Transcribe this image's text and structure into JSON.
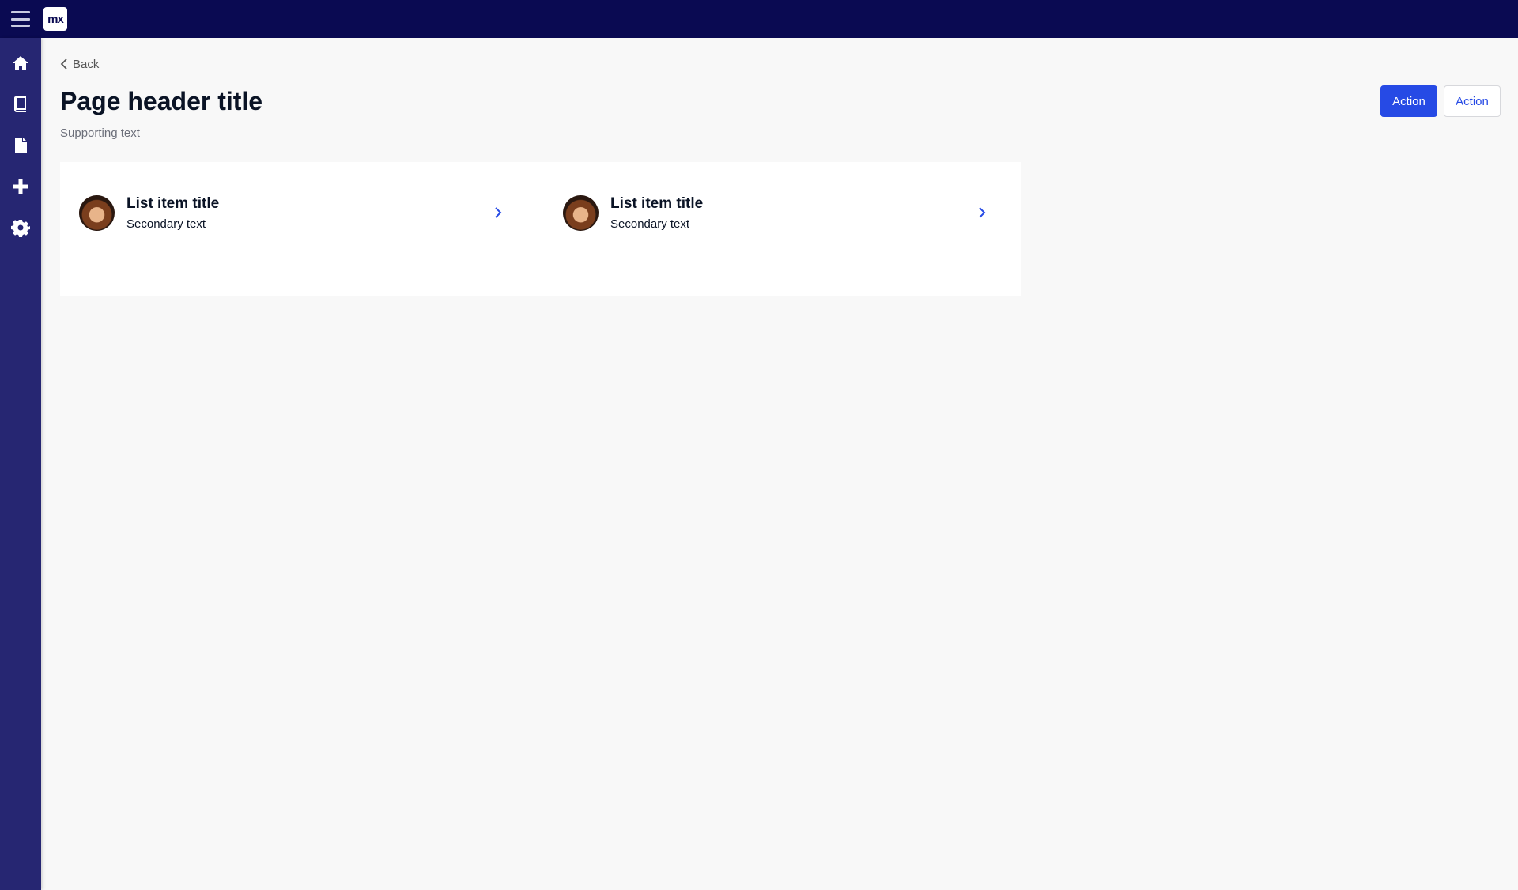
{
  "app": {
    "logo_text": "mx"
  },
  "sidebar": {
    "items": [
      {
        "icon": "home-icon"
      },
      {
        "icon": "book-icon"
      },
      {
        "icon": "file-icon"
      },
      {
        "icon": "plus-icon"
      },
      {
        "icon": "gear-icon"
      }
    ]
  },
  "header": {
    "back_label": "Back",
    "title": "Page header title",
    "supporting_text": "Supporting text",
    "primary_action": "Action",
    "secondary_action": "Action"
  },
  "list": {
    "items": [
      {
        "title": "List item title",
        "secondary": "Secondary text"
      },
      {
        "title": "List item title",
        "secondary": "Secondary text"
      }
    ]
  },
  "colors": {
    "topbar": "#0a0a52",
    "sidebar": "#262672",
    "primary": "#264ae5",
    "background": "#f8f8f8"
  }
}
